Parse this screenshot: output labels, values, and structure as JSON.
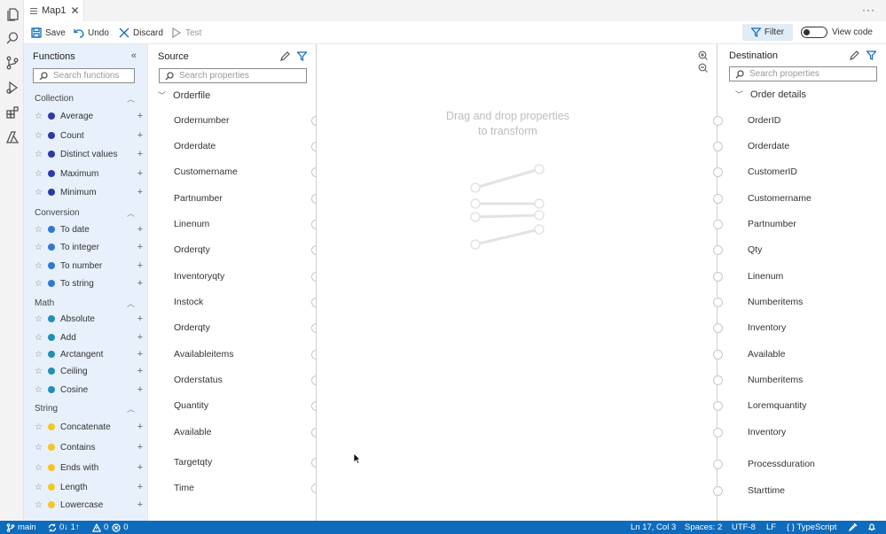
{
  "tab": {
    "title": "Map1"
  },
  "toolbar": {
    "save": "Save",
    "undo": "Undo",
    "discard": "Discard",
    "test": "Test",
    "filter": "Filter",
    "view_code": "View code"
  },
  "functions": {
    "title": "Functions",
    "search_placeholder": "Search functions",
    "categories": [
      {
        "name": "Collection",
        "color": "#2b3aa8",
        "items": [
          "Average",
          "Count",
          "Distinct values",
          "Maximum",
          "Minimum"
        ]
      },
      {
        "name": "Conversion",
        "color": "#2f78d6",
        "items": [
          "To date",
          "To integer",
          "To number",
          "To string"
        ]
      },
      {
        "name": "Math",
        "color": "#1f8fb5",
        "items": [
          "Absolute",
          "Add",
          "Arctangent",
          "Ceiling",
          "Cosine"
        ]
      },
      {
        "name": "String",
        "color": "#f3c624",
        "items": [
          "Concatenate",
          "Contains",
          "Ends with",
          "Length",
          "Lowercase"
        ]
      }
    ]
  },
  "source": {
    "title": "Source",
    "search_placeholder": "Search properties",
    "root": "Orderfile",
    "properties": [
      "Ordernumber",
      "Orderdate",
      "Customername",
      "Partnumber",
      "Linenum",
      "Orderqty",
      "Inventoryqty",
      "Instock",
      "Orderqty",
      "Availableitems",
      "Orderstatus",
      "Quantity",
      "Available",
      "Targetqty",
      "Time"
    ]
  },
  "canvas": {
    "hint_line1": "Drag and drop properties",
    "hint_line2": "to transform"
  },
  "destination": {
    "title": "Destination",
    "search_placeholder": "Search properties",
    "root": "Order details",
    "properties": [
      "OrderID",
      "Orderdate",
      "CustomerID",
      "Customername",
      "Partnumber",
      "Qty",
      "Linenum",
      "Numberitems",
      "Inventory",
      "Available",
      "Numberitems",
      "Loremquantity",
      "Inventory",
      "Processduration",
      "Starttime"
    ]
  },
  "statusbar": {
    "branch": "main",
    "sync": "0↓ 1↑",
    "problems": "0",
    "errors": "0",
    "position": "Ln 17, Col 3",
    "spaces": "Spaces: 2",
    "encoding": "UTF-8",
    "eol": "LF",
    "language": "{ } TypeScript"
  },
  "colors": {
    "accent": "#0f6cbd",
    "panel_bg": "#e8f0fb"
  }
}
